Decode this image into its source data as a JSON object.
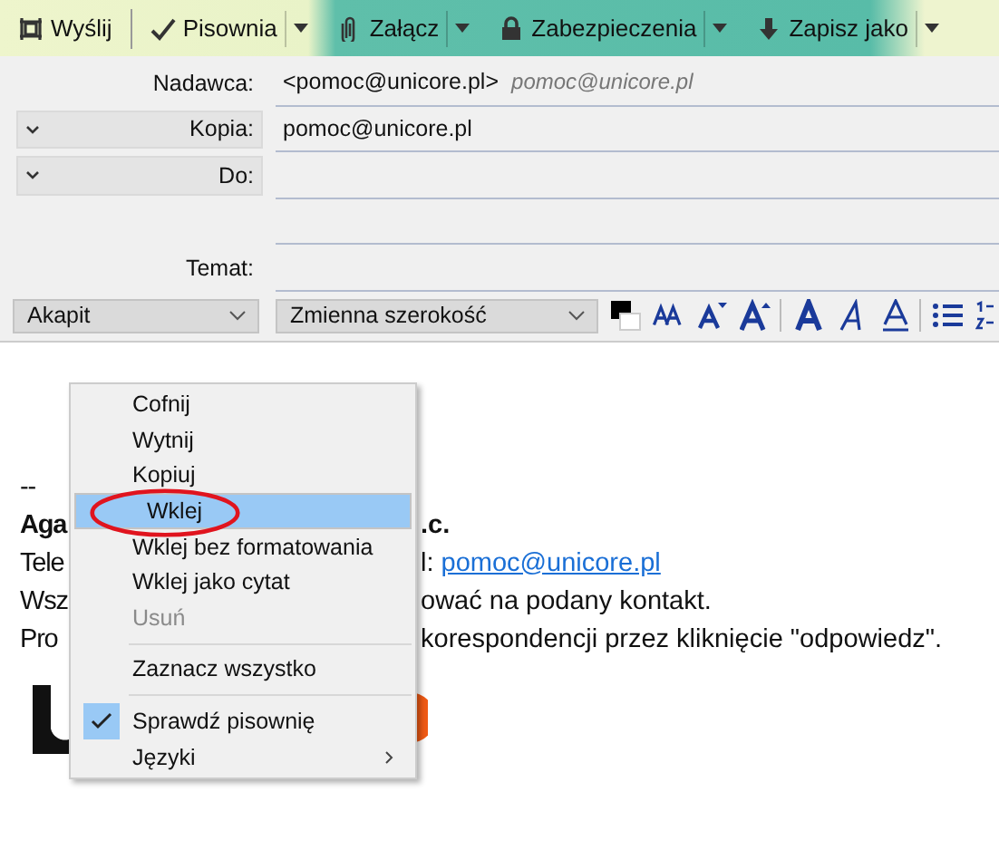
{
  "toolbar": {
    "buttons": [
      {
        "label": "Wyślij",
        "dropdown": false
      },
      {
        "label": "Pisownia",
        "dropdown": true
      },
      {
        "label": "Załącz",
        "dropdown": true
      },
      {
        "label": "Zabezpieczenia",
        "dropdown": true
      },
      {
        "label": "Zapisz jako",
        "dropdown": true
      }
    ]
  },
  "header": {
    "fields": [
      {
        "label": "Nadawca:",
        "value": "<pomoc@unicore.pl>",
        "hint": "pomoc@unicore.pl",
        "toggle": false
      },
      {
        "label": "Kopia:",
        "value": "pomoc@unicore.pl",
        "toggle": true
      },
      {
        "label": "Do:",
        "toggle": true
      },
      {
        "toggle": false
      },
      {
        "label": "Temat:",
        "toggle": false
      }
    ]
  },
  "format_bar": {
    "paragraph": "Akapit",
    "font": "Zmienna szerokość"
  },
  "body": {
    "lines": [
      {
        "left": "--",
        "bold": false
      },
      {
        "left": "Aga",
        "right": ".c.",
        "bold": true
      },
      {
        "left": "Tele",
        "right": "l: ",
        "link": "pomoc@unicore.pl",
        "bold": false
      },
      {
        "left": "Wsz",
        "right": "ować na podany kontakt.",
        "bold": false
      },
      {
        "left": "Pro",
        "right": "korespondencji przez kliknięcie \"odpowiedz\".",
        "bold": false
      }
    ]
  },
  "context_menu": {
    "items": [
      {
        "kind": "item",
        "label": "Cofnij",
        "selected": false,
        "disabled": false,
        "checked": false,
        "submenu": false
      },
      {
        "kind": "item",
        "label": "Wytnij",
        "selected": false,
        "disabled": false,
        "checked": false,
        "submenu": false
      },
      {
        "kind": "item",
        "label": "Kopiuj",
        "selected": false,
        "disabled": false,
        "checked": false,
        "submenu": false
      },
      {
        "kind": "item",
        "label": "Wklej",
        "selected": true,
        "disabled": false,
        "checked": false,
        "submenu": false,
        "circled": true
      },
      {
        "kind": "item",
        "label": "Wklej bez formatowania",
        "selected": false,
        "disabled": false,
        "checked": false,
        "submenu": false
      },
      {
        "kind": "item",
        "label": "Wklej jako cytat",
        "selected": false,
        "disabled": false,
        "checked": false,
        "submenu": false
      },
      {
        "kind": "item",
        "label": "Usuń",
        "selected": false,
        "disabled": true,
        "checked": false,
        "submenu": false
      },
      {
        "kind": "separator"
      },
      {
        "kind": "item",
        "label": "Zaznacz wszystko",
        "selected": false,
        "disabled": false,
        "checked": false,
        "submenu": false
      },
      {
        "kind": "separator"
      },
      {
        "kind": "item",
        "label": "Sprawdź pisownię",
        "selected": false,
        "disabled": false,
        "checked": true,
        "submenu": false
      },
      {
        "kind": "item",
        "label": "Języki",
        "selected": false,
        "disabled": false,
        "checked": false,
        "submenu": true
      }
    ]
  }
}
